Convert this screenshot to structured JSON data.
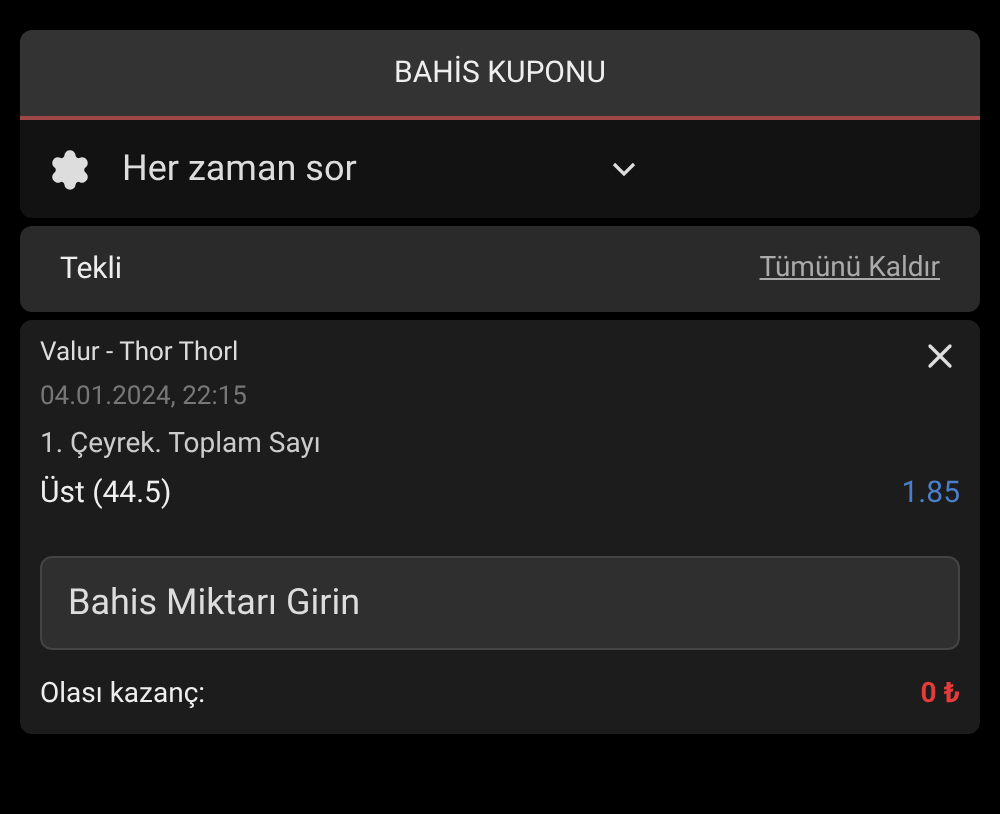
{
  "header": {
    "title": "BAHİS KUPONU"
  },
  "odds_setting": {
    "value": "Her zaman sor"
  },
  "bet_type": {
    "label": "Tekli",
    "clear_link": "Tümünü Kaldır"
  },
  "selection": {
    "match": "Valur - Thor Thorl",
    "datetime": "04.01.2024, 22:15",
    "market": "1. Çeyrek. Toplam Sayı",
    "pick": "Üst (44.5)",
    "odds": "1.85"
  },
  "stake": {
    "placeholder": "Bahis Miktarı Girin"
  },
  "payout": {
    "label": "Olası kazanç:",
    "value": "0 ₺"
  }
}
